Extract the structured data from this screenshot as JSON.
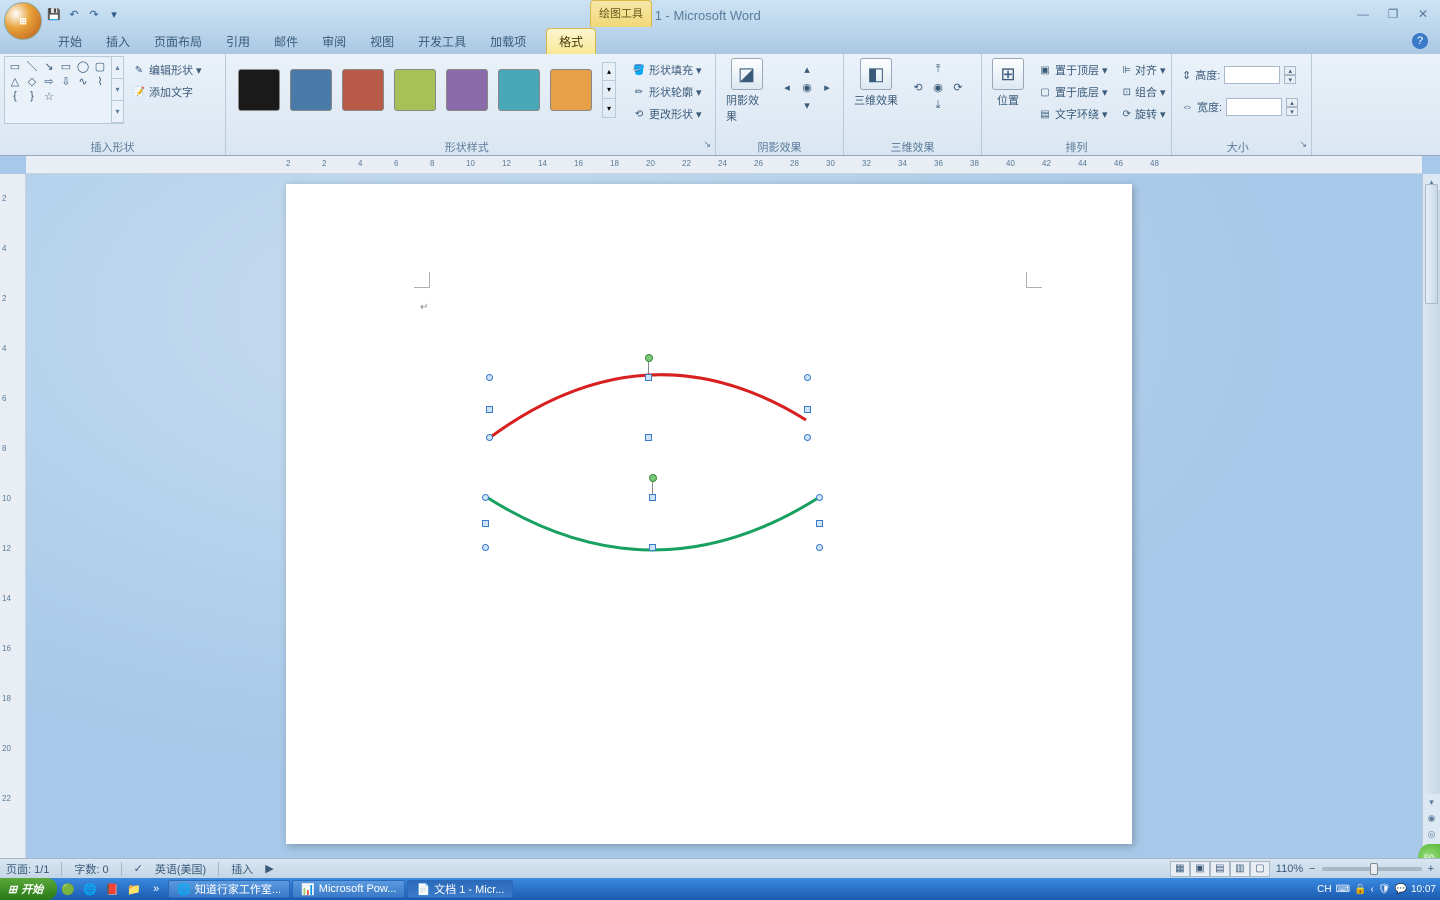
{
  "title": {
    "doc": "文档 1",
    "app": "Microsoft Word",
    "ctx_tab": "绘图工具"
  },
  "tabs": {
    "home": "开始",
    "insert": "插入",
    "layout": "页面布局",
    "ref": "引用",
    "mail": "邮件",
    "review": "审阅",
    "view": "视图",
    "dev": "开发工具",
    "addin": "加载项",
    "format": "格式"
  },
  "groups": {
    "insert_shapes": "插入形状",
    "edit_shape": "编辑形状",
    "add_text": "添加文字",
    "shape_styles": "形状样式",
    "shape_fill": "形状填充",
    "shape_outline": "形状轮廓",
    "change_shape": "更改形状",
    "shadow": "阴影效果",
    "threed": "三维效果",
    "arrange": "排列",
    "size": "大小",
    "position": "位置",
    "bring_front": "置于顶层",
    "send_back": "置于底层",
    "text_wrap": "文字环绕",
    "align": "对齐",
    "group_btn": "组合",
    "rotate": "旋转",
    "height": "高度:",
    "width": "宽度:"
  },
  "swatches": [
    "#1a1a1a",
    "#4a7aa8",
    "#b85a48",
    "#a8c058",
    "#8a6aa8",
    "#48a8b8",
    "#e8a048"
  ],
  "hruler_ticks": [
    "2",
    "2",
    "4",
    "6",
    "8",
    "10",
    "12",
    "14",
    "16",
    "18",
    "20",
    "22",
    "24",
    "26",
    "28",
    "30",
    "32",
    "34",
    "36",
    "38",
    "40",
    "42",
    "44",
    "46",
    "48"
  ],
  "vruler_ticks": [
    "2",
    "4",
    "2",
    "4",
    "6",
    "8",
    "10",
    "12",
    "14",
    "16",
    "18",
    "20",
    "22"
  ],
  "status": {
    "page": "页面: 1/1",
    "words": "字数: 0",
    "lang": "英语(美国)",
    "mode": "插入",
    "zoom": "110%"
  },
  "taskbar": {
    "start": "开始",
    "tasks": [
      {
        "ico": "🌐",
        "label": "知道行家工作室..."
      },
      {
        "ico": "📊",
        "label": "Microsoft Pow..."
      },
      {
        "ico": "📄",
        "label": "文档 1 - Micr..."
      }
    ],
    "tray": {
      "ime": "CH",
      "time": "10:07"
    }
  },
  "size_vals": {
    "h": "",
    "w": ""
  }
}
